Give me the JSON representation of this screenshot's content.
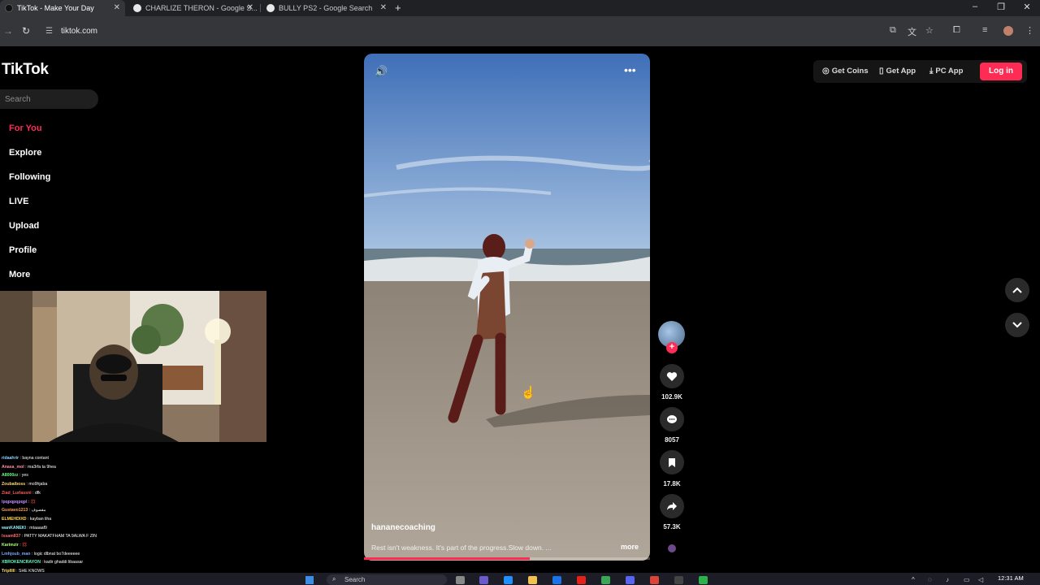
{
  "browser": {
    "tabs": [
      {
        "title": "TikTok - Make Your Day",
        "active": true,
        "favicon_color": "#000000"
      },
      {
        "title": "CHARLIZE THERON - Google S...",
        "active": false,
        "favicon_color": "#e0e0e0"
      },
      {
        "title": "BULLY PS2 - Google Search",
        "active": false,
        "favicon_color": "#e0e0e0"
      }
    ],
    "url": "tiktok.com"
  },
  "sidebar": {
    "logo": "TikTok",
    "search_placeholder": "Search",
    "items": [
      {
        "label": "For You",
        "active": true
      },
      {
        "label": "Explore",
        "active": false
      },
      {
        "label": "Following",
        "active": false
      },
      {
        "label": "LIVE",
        "active": false
      },
      {
        "label": "Upload",
        "active": false
      },
      {
        "label": "Profile",
        "active": false
      },
      {
        "label": "More",
        "active": false
      }
    ]
  },
  "header": {
    "get_coins": "Get Coins",
    "get_app": "Get App",
    "pc_app": "PC App",
    "login": "Log in"
  },
  "video": {
    "author": "hananecoaching",
    "caption": "Rest isn't weakness. It's part of the progress.Slow down. ...",
    "more": "more",
    "progress": 0.58
  },
  "actions": {
    "likes": "102.9K",
    "comments": "8057",
    "saves": "17.8K",
    "shares": "57.3K"
  },
  "chat": [
    {
      "user": "ridaahrir",
      "msg": ": bayna contant",
      "color": "#7fd3ff"
    },
    {
      "user": "Anasa_mol",
      "msg": ": ma3rfa ta 9hea",
      "color": "#ff8fa3"
    },
    {
      "user": "A8000zz",
      "msg": ": yes",
      "color": "#6cff8b"
    },
    {
      "user": "Zoubaiboss",
      "msg": ": mo9hjaba",
      "color": "#ffd76c"
    },
    {
      "user": "Ziad_Lurlassni",
      "msg": ": dfk",
      "color": "#ff5a5a"
    },
    {
      "user": "lpqpqpqpqpl",
      "msg": ": 💢",
      "color": "#c38bff"
    },
    {
      "user": "Gustavo1213",
      "msg": ": مقصوف",
      "color": "#ff9d4d"
    },
    {
      "user": "ELMEHDIXD",
      "msg": ": kayban liha",
      "color": "#ffd34d"
    },
    {
      "user": "wanKANEKI",
      "msg": ": mtaaaaf9",
      "color": "#8af0ff"
    },
    {
      "user": "lssam837",
      "msg": ": PATTY MAKATFHAM TA 9ALWA F ZIN",
      "color": "#ff6b6b"
    },
    {
      "user": "Karimzir",
      "msg": ": 💢",
      "color": "#b0ff7a"
    },
    {
      "user": "Lmhjoub_man",
      "msg": ": logic dlbnat bo7deeeeee",
      "color": "#7aa8ff"
    },
    {
      "user": "XBROKENCRAYON",
      "msg": ": kadir ghaddi libaasar",
      "color": "#5affc8"
    },
    {
      "user": "Triplllll",
      "msg": ": SHE KNOWS",
      "color": "#ffe066"
    },
    {
      "user": "lssam837",
      "msg": ": PATTY MAKATFHAM TA 9ALWA F ZIN",
      "color": "#ff6b6b"
    }
  ],
  "taskbar": {
    "search_label": "Search",
    "time": "12:31 AM"
  },
  "colors": {
    "accent": "#fe2c55",
    "background": "#000000"
  }
}
